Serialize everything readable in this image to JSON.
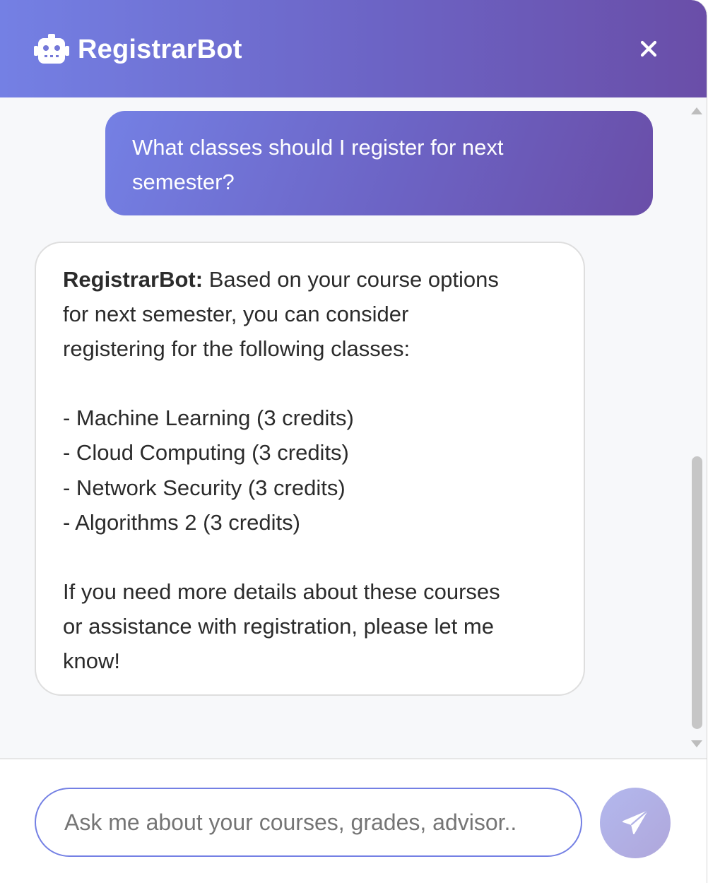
{
  "header": {
    "title": "RegistrarBot",
    "bot_icon": "robot-icon",
    "close_icon": "close-icon",
    "close_glyph": "✕"
  },
  "messages": {
    "user": {
      "lines": [
        "What classes should I register for next",
        "semester?"
      ]
    },
    "bot": {
      "sender": "RegistrarBot:",
      "first_line_rest": " Based on your course options",
      "lines": [
        "for next semester, you can consider",
        "registering for the following classes:",
        "",
        "- Machine Learning (3 credits)",
        "- Cloud Computing (3 credits)",
        "- Network Security (3 credits)",
        "- Algorithms 2 (3 credits)",
        "",
        "If you need more details about these courses",
        "or assistance with registration, please let me",
        "know!"
      ]
    }
  },
  "composer": {
    "placeholder": "Ask me about your courses, grades, advisor..",
    "value": "",
    "send_icon": "paper-plane-icon"
  },
  "colors": {
    "accent_start": "#7480e4",
    "accent_end": "#6a4ea8",
    "send_button": "#b2b8ee"
  }
}
